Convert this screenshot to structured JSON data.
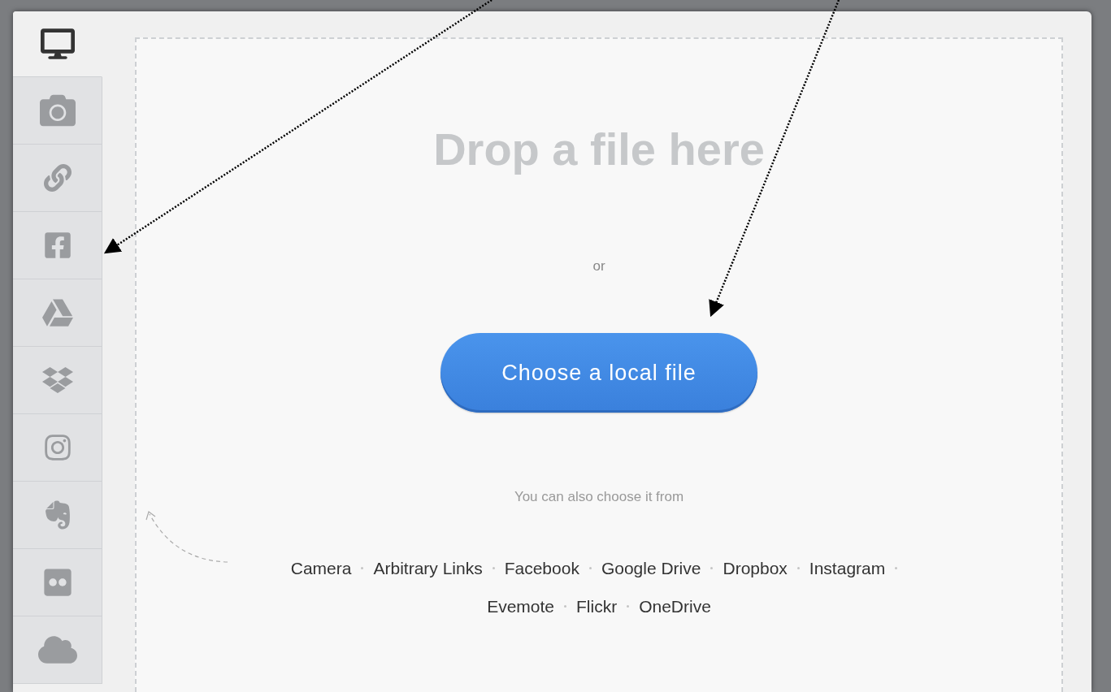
{
  "sidebar": {
    "items": [
      {
        "kind": "computer",
        "selected": true
      },
      {
        "kind": "camera",
        "selected": false
      },
      {
        "kind": "link",
        "selected": false
      },
      {
        "kind": "facebook",
        "selected": false
      },
      {
        "kind": "drive",
        "selected": false
      },
      {
        "kind": "dropbox",
        "selected": false
      },
      {
        "kind": "instagram",
        "selected": false
      },
      {
        "kind": "evernote",
        "selected": false
      },
      {
        "kind": "flickr",
        "selected": false
      },
      {
        "kind": "cloud",
        "selected": false
      }
    ]
  },
  "drop_zone": {
    "heading": "Drop a file here",
    "separator": "or",
    "button": "Choose a local file",
    "hint": "You can also choose it from",
    "sources": [
      [
        "Camera",
        "Arbitrary Links",
        "Facebook",
        "Google Drive",
        "Dropbox",
        "Instagram"
      ],
      [
        "Evemote",
        "Flickr",
        "OneDrive"
      ]
    ]
  }
}
